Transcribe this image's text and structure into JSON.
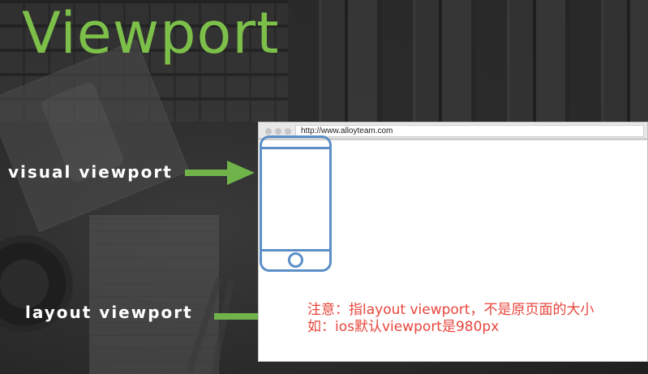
{
  "slide": {
    "title": "Viewport",
    "visual_label": "visual viewport",
    "layout_label": "layout viewport"
  },
  "browser": {
    "url": "http://www.alloyteam.com"
  },
  "note": {
    "line1": "注意：指layout viewport，不是原页面的大小",
    "line2": "如：ios默认viewport是980px"
  },
  "colors": {
    "title": "#7cc04a",
    "arrow": "#6fb34a",
    "phone_outline": "#5b8ec7",
    "note_text": "#e8453c",
    "label_text": "#ffffff"
  }
}
